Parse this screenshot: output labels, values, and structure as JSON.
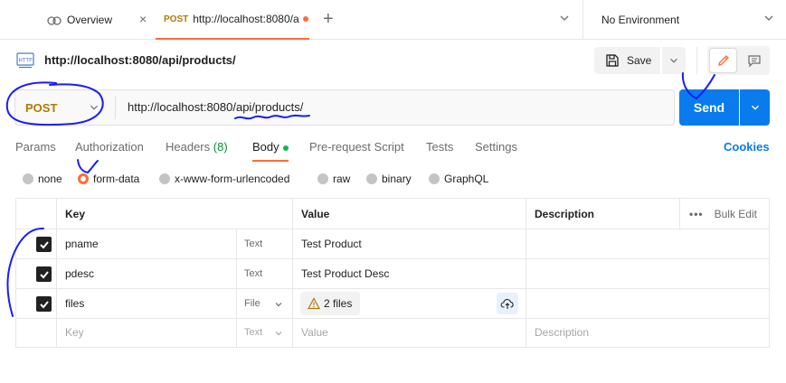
{
  "tabs": {
    "overview_label": "Overview",
    "active_method": "POST",
    "active_label": "http://localhost:8080/a"
  },
  "environment": {
    "label": "No Environment"
  },
  "request": {
    "title": "http://localhost:8080/api/products/",
    "save_label": "Save",
    "method": "POST",
    "url": "http://localhost:8080/api/products/",
    "send_label": "Send"
  },
  "subtabs": {
    "params": "Params",
    "authorization": "Authorization",
    "headers": "Headers",
    "headers_count": "(8)",
    "body": "Body",
    "prerequest": "Pre-request Script",
    "tests": "Tests",
    "settings": "Settings",
    "cookies": "Cookies"
  },
  "body_types": {
    "none": "none",
    "form_data": "form-data",
    "urlencoded": "x-www-form-urlencoded",
    "raw": "raw",
    "binary": "binary",
    "graphql": "GraphQL"
  },
  "table": {
    "headers": {
      "key": "Key",
      "value": "Value",
      "description": "Description",
      "bulk_edit": "Bulk Edit",
      "more": "•••"
    },
    "rows": [
      {
        "key": "pname",
        "type": "Text",
        "value": "Test Product"
      },
      {
        "key": "pdesc",
        "type": "Text",
        "value": "Test Product Desc"
      },
      {
        "key": "files",
        "type": "File",
        "value": "2 files"
      }
    ],
    "placeholder": {
      "key": "Key",
      "type": "Text",
      "value": "Value",
      "description": "Description"
    }
  },
  "colors": {
    "accent": "#ff6c37",
    "send": "#097bed",
    "method": "#ad7a03",
    "annotation": "#1a1aff"
  },
  "icons": {
    "overview": "overview-icon",
    "http": "http-file-icon",
    "save": "save-disk-icon",
    "edit": "pencil-icon",
    "comment": "comment-icon",
    "warning": "warning-icon",
    "upload": "cloud-upload-icon"
  }
}
